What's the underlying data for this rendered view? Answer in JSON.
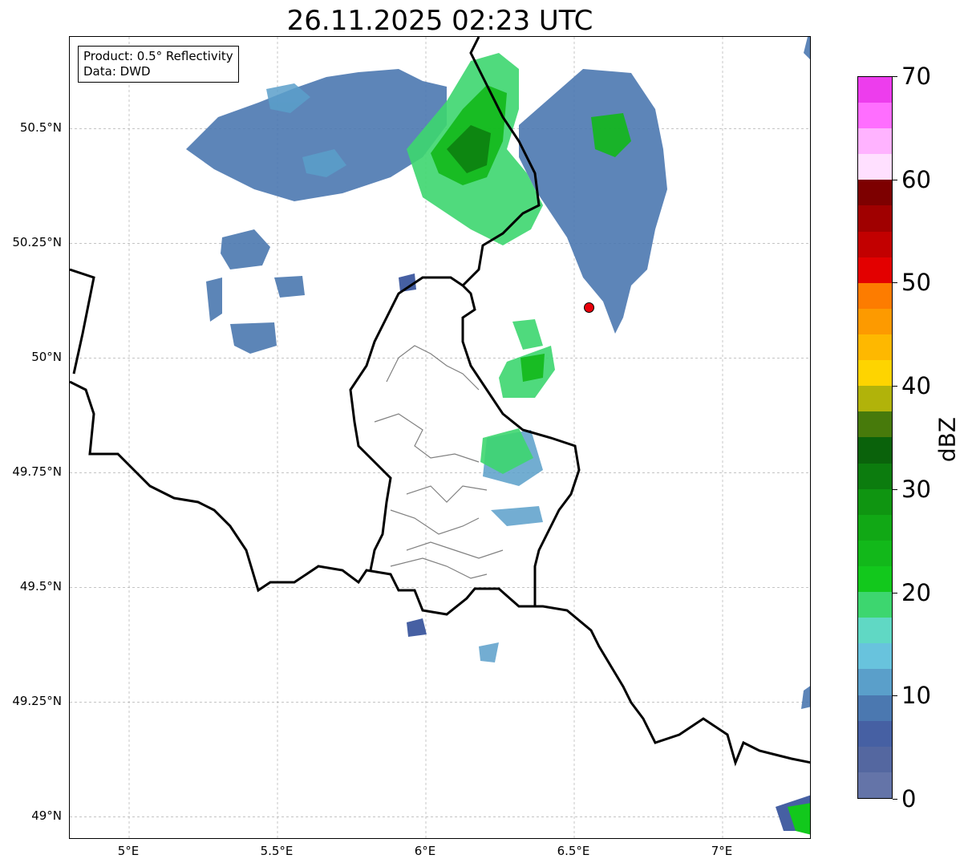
{
  "title": "26.11.2025 02:23 UTC",
  "info_box": {
    "product": "Product: 0.5° Reflectivity",
    "data_source": "Data: DWD"
  },
  "map": {
    "extent": {
      "lon_min": 4.8,
      "lon_max": 7.3,
      "lat_min": 48.95,
      "lat_max": 50.7
    },
    "x_ticks": [
      {
        "value": 5.0,
        "label": "5°E"
      },
      {
        "value": 5.5,
        "label": "5.5°E"
      },
      {
        "value": 6.0,
        "label": "6°E"
      },
      {
        "value": 6.5,
        "label": "6.5°E"
      },
      {
        "value": 7.0,
        "label": "7°E"
      }
    ],
    "y_ticks": [
      {
        "value": 49.0,
        "label": "49°N"
      },
      {
        "value": 49.25,
        "label": "49.25°N"
      },
      {
        "value": 49.5,
        "label": "49.5°N"
      },
      {
        "value": 49.75,
        "label": "49.75°N"
      },
      {
        "value": 50.0,
        "label": "50°N"
      },
      {
        "value": 50.25,
        "label": "50.25°N"
      },
      {
        "value": 50.5,
        "label": "50.5°N"
      }
    ],
    "gridlines": true,
    "marker": {
      "lon": 6.55,
      "lat": 50.11,
      "color": "#e8000b"
    },
    "colors": {
      "country_border": "#000000",
      "canton_border": "#808080",
      "grid": "#b0b0b0"
    }
  },
  "colorbar": {
    "label": "dBZ",
    "min": 0,
    "max": 70,
    "ticks": [
      0,
      10,
      20,
      30,
      40,
      50,
      60,
      70
    ],
    "colors": [
      "#6474a8",
      "#5467a0",
      "#4660a3",
      "#4b78b0",
      "#5a9fca",
      "#68c3dd",
      "#60d8c4",
      "#3dd66f",
      "#12c81c",
      "#12b81a",
      "#11a815",
      "#0f9511",
      "#0c7c0e",
      "#0a620b",
      "#477a0b",
      "#b1b30a",
      "#fed400",
      "#feb800",
      "#fd9a00",
      "#fd7c00",
      "#e30000",
      "#c20000",
      "#a00000",
      "#7d0000",
      "#ffe0ff",
      "#ffb3ff",
      "#ff6eff",
      "#ed3ded"
    ]
  }
}
